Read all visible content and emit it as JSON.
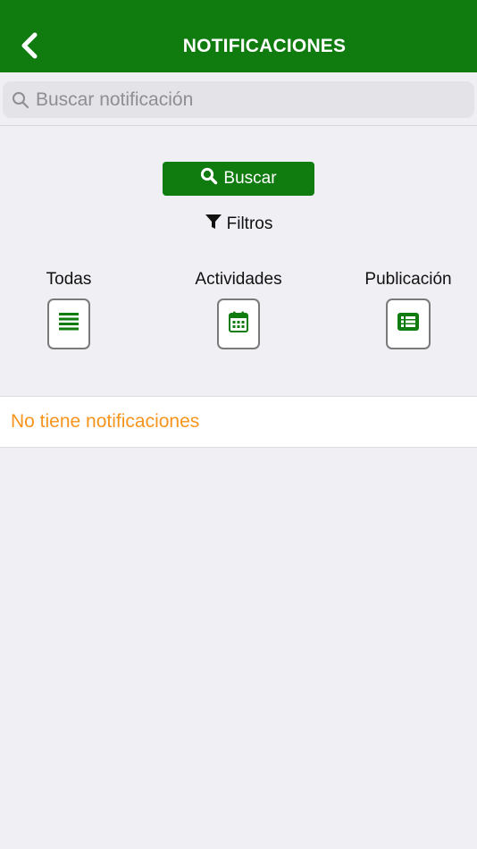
{
  "header": {
    "title": "NOTIFICACIONES",
    "back_icon": "chevron-left-icon"
  },
  "search": {
    "placeholder": "Buscar notificación",
    "value": ""
  },
  "actions": {
    "search_label": "Buscar",
    "filters_label": "Filtros"
  },
  "categories": [
    {
      "label": "Todas",
      "icon": "list-lines-icon"
    },
    {
      "label": "Actividades",
      "icon": "calendar-icon"
    },
    {
      "label": "Publicación",
      "icon": "list-card-icon"
    }
  ],
  "empty_message": "No tiene notificaciones",
  "colors": {
    "brand_green": "#107c10",
    "empty_text": "#f7941d",
    "background": "#efeff4"
  }
}
